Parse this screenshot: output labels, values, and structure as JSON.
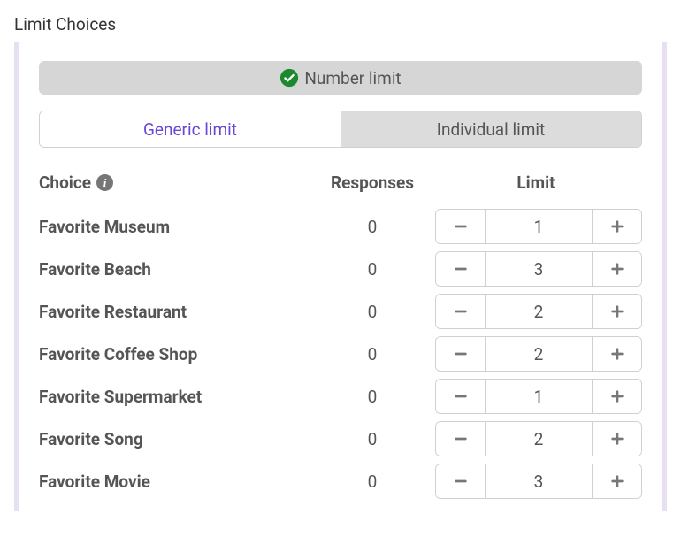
{
  "page": {
    "title": "Limit Choices"
  },
  "banner": {
    "label": "Number limit"
  },
  "tabs": {
    "generic": "Generic limit",
    "individual": "Individual limit",
    "active": "generic"
  },
  "columns": {
    "choice": "Choice",
    "responses": "Responses",
    "limit": "Limit"
  },
  "rows": [
    {
      "name": "Favorite Museum",
      "responses": 0,
      "limit": 1
    },
    {
      "name": "Favorite Beach",
      "responses": 0,
      "limit": 3
    },
    {
      "name": "Favorite Restaurant",
      "responses": 0,
      "limit": 2
    },
    {
      "name": "Favorite Coffee Shop",
      "responses": 0,
      "limit": 2
    },
    {
      "name": "Favorite Supermarket",
      "responses": 0,
      "limit": 1
    },
    {
      "name": "Favorite Song",
      "responses": 0,
      "limit": 2
    },
    {
      "name": "Favorite Movie",
      "responses": 0,
      "limit": 3
    }
  ]
}
